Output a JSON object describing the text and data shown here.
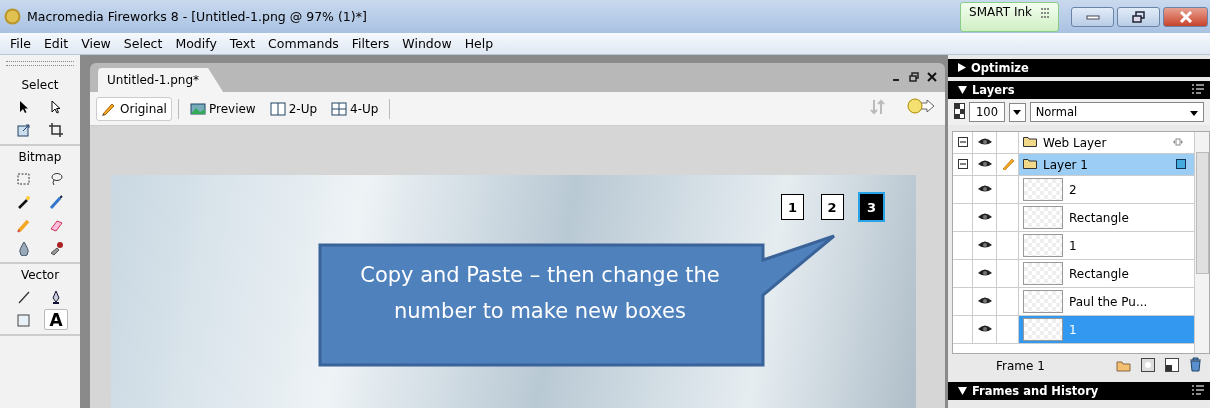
{
  "window": {
    "title": "Macromedia Fireworks 8 - [Untitled-1.png @  97% (1)*]",
    "widget": "SMART Ink"
  },
  "menu": [
    "File",
    "Edit",
    "View",
    "Select",
    "Modify",
    "Text",
    "Commands",
    "Filters",
    "Window",
    "Help"
  ],
  "tools": {
    "sections": [
      {
        "title": "Select",
        "tools": [
          {
            "kind": "pointer",
            "selected": false
          },
          {
            "kind": "subselect",
            "selected": false
          },
          {
            "kind": "scale",
            "selected": false
          },
          {
            "kind": "crop",
            "selected": false
          }
        ]
      },
      {
        "title": "Bitmap",
        "tools": [
          {
            "kind": "marquee",
            "selected": false
          },
          {
            "kind": "lasso",
            "selected": false
          },
          {
            "kind": "wand",
            "selected": false
          },
          {
            "kind": "brush",
            "selected": false
          },
          {
            "kind": "pencil",
            "selected": false
          },
          {
            "kind": "eraser",
            "selected": false
          },
          {
            "kind": "blur",
            "selected": false
          },
          {
            "kind": "stamp",
            "selected": false
          }
        ]
      },
      {
        "title": "Vector",
        "tools": [
          {
            "kind": "line",
            "selected": false
          },
          {
            "kind": "pen",
            "selected": false
          },
          {
            "kind": "rect",
            "selected": false
          },
          {
            "kind": "text",
            "glyph": "A",
            "selected": true
          }
        ]
      }
    ]
  },
  "document": {
    "tab": "Untitled-1.png*",
    "views": [
      {
        "label": "Original",
        "kind": "original",
        "selected": true
      },
      {
        "label": "Preview",
        "kind": "preview",
        "selected": false
      },
      {
        "label": "2-Up",
        "kind": "two",
        "selected": false
      },
      {
        "label": "4-Up",
        "kind": "four",
        "selected": false
      }
    ],
    "number_boxes": [
      {
        "label": "1",
        "selected": false
      },
      {
        "label": "2",
        "selected": false
      },
      {
        "label": "3",
        "selected": true
      }
    ],
    "callout": "Copy and Paste – then change the number to make new boxes"
  },
  "panels": [
    {
      "title": "Optimize",
      "expanded": false
    },
    {
      "title": "Layers",
      "expanded": true
    }
  ],
  "layers": {
    "opacity": "100",
    "blend": "Normal",
    "items": [
      {
        "name": "Web Layer",
        "kind": "web",
        "expanded": true,
        "active": false
      },
      {
        "name": "Layer 1",
        "kind": "layer",
        "expanded": true,
        "active": true,
        "children": [
          {
            "name": "2",
            "selected": false
          },
          {
            "name": "Rectangle",
            "selected": false
          },
          {
            "name": "1",
            "selected": false
          },
          {
            "name": "Rectangle",
            "selected": false
          },
          {
            "name": "Paul the Pu...",
            "selected": false
          },
          {
            "name": "1",
            "selected": true
          }
        ]
      }
    ],
    "frame": "Frame 1"
  },
  "bottom_panel": {
    "title": "Frames and History",
    "expanded": true
  }
}
